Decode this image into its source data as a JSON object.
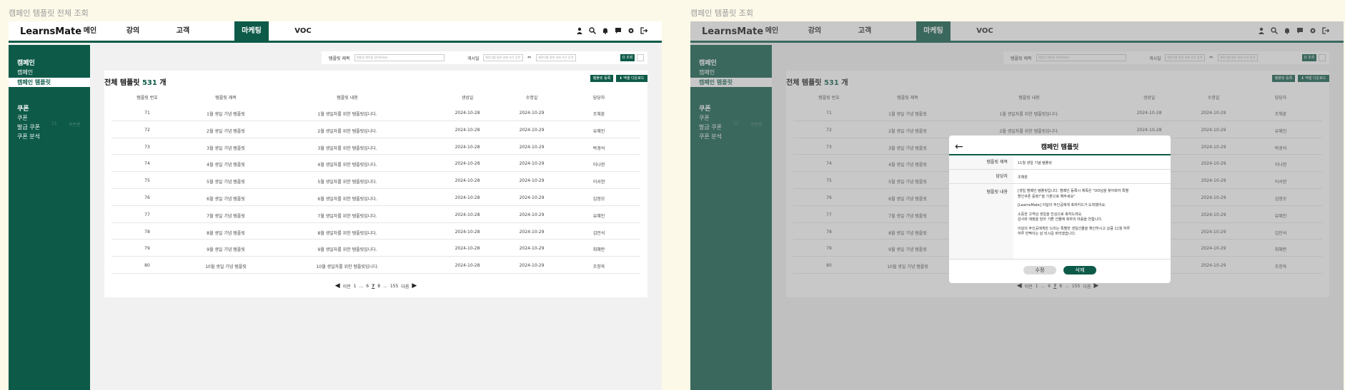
{
  "screens": [
    {
      "caption": "캠페인 템플릿 전체 조회"
    },
    {
      "caption": "캠페인 템플릿 조회"
    }
  ],
  "app": {
    "logo": "LearnsMate",
    "nav": [
      "메인",
      "강의",
      "고객",
      "마케팅",
      "VOC"
    ],
    "active_nav": "마케팅"
  },
  "sidebar": {
    "groups": [
      {
        "title": "캠페인",
        "items": [
          "캠페인",
          "캠페인 템플릿"
        ]
      },
      {
        "title": "쿠폰",
        "items": [
          "쿠폰",
          "발급 쿠폰",
          "쿠폰 분석"
        ]
      }
    ],
    "selected": "캠페인 템플릿",
    "ghost_text": [
      "11",
      "쿠폰편"
    ]
  },
  "search": {
    "title_label": "템플릿 제목",
    "title_placeholder": "템플릿 제목을 입력하세요.",
    "date_label": "게시일",
    "date_start_placeholder": "캘린더를 통한 날짜 조건 입력",
    "date_sep": "⇔",
    "date_end_placeholder": "캘린더를 통한 날짜 조건 입력",
    "search_btn": "Q 조회"
  },
  "list": {
    "title_prefix": "전체 템플릿",
    "count": "531",
    "title_suffix": "개",
    "register_btn": "템플릿 등록",
    "excel_btn": "⬇ 엑셀 다운로드",
    "columns": [
      "템플릿 번호",
      "템플릿 제목",
      "템플릿 내용",
      "생성일",
      "수정일",
      "담당자"
    ],
    "rows": [
      [
        "71",
        "1월 생일 기념 템플릿",
        "1월 생일자를 위한 템플릿입니다.",
        "2024-10-28",
        "2024-10-29",
        "조채훈"
      ],
      [
        "72",
        "2월 생일 기념 템플릿",
        "2월 생일자를 위한 템플릿입니다.",
        "2024-10-28",
        "2024-10-29",
        "유혜진"
      ],
      [
        "73",
        "3월 생일 기념 템플릿",
        "3월 생일자를 위한 템플릿입니다.",
        "2024-10-28",
        "2024-10-29",
        "박경석"
      ],
      [
        "74",
        "4월 생일 기념 템플릿",
        "4월 생일자를 위한 템플릿입니다.",
        "2024-10-28",
        "2024-10-29",
        "이나현"
      ],
      [
        "75",
        "5월 생일 기념 템플릿",
        "5월 생일자를 위한 템플릿입니다.",
        "2024-10-28",
        "2024-10-29",
        "이서현"
      ],
      [
        "76",
        "6월 생일 기념 템플릿",
        "6월 생일자를 위한 템플릿입니다.",
        "2024-10-28",
        "2024-10-29",
        "김정모"
      ],
      [
        "77",
        "7월 생일 기념 템플릿",
        "7월 생일자를 위한 템플릿입니다.",
        "2024-10-28",
        "2024-10-29",
        "유혜진"
      ],
      [
        "78",
        "8월 생일 기념 템플릿",
        "8월 생일자를 위한 템플릿입니다.",
        "2024-10-28",
        "2024-10-29",
        "김민석"
      ],
      [
        "79",
        "9월 생일 기념 템플릿",
        "9월 생일자를 위한 템플릿입니다.",
        "2024-10-28",
        "2024-10-29",
        "최혜란"
      ],
      [
        "80",
        "10월 생일 기념 템플릿",
        "10월 생일자를 위한 템플릿입니다.",
        "2024-10-28",
        "2024-10-29",
        "조창욱"
      ]
    ],
    "pager": [
      "◀",
      "이전",
      "1",
      "...",
      "6",
      "7",
      "8",
      "...",
      "155",
      "다음",
      "▶"
    ],
    "current_page": "7"
  },
  "modal": {
    "back_icon": "←",
    "title": "캠페인 템플릿",
    "fields": {
      "title_label": "템플릿 제목",
      "title_value": "11월 생일 기념 템플릿",
      "owner_label": "담당자",
      "owner_value": "조채훈",
      "content_label": "템플릿 내용",
      "content_lines": [
        "[생일 캠페인 템플릿입니다. 캠페인 등록시 제목은 \"OO님을 찾아뵈어 특별",
        "할인쿠폰 증정!\"을 기본으로 해주세요\"",
        "",
        "[LearnsMate] 이달의 주인공에게 축하카드가 도착했어요.",
        "",
        "소중한 고객님 생일을 진심으로 축하드려요.",
        "감사와 애정을 담아 기쁜 선물에 축하의 마음을 전합니다.",
        "",
        "이달의 주인공에게만 드리는 특별한 생일선물을 확인하시고 상큼 11월 하루",
        "하루 반짝이는 날 되시길 바라겠습니다."
      ]
    },
    "edit_btn": "수정",
    "delete_btn": "삭제"
  },
  "colors": {
    "brand": "#0d5a48",
    "background": "#fdf9e8"
  },
  "icons": [
    "user-icon",
    "search-icon",
    "bell-icon",
    "message-icon",
    "gear-icon",
    "logout-icon"
  ]
}
